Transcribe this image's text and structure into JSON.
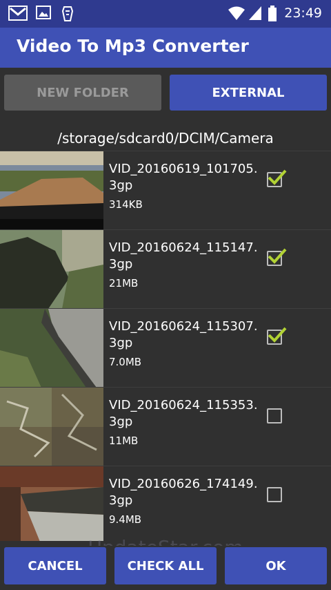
{
  "status_bar": {
    "time": "23:49",
    "icons": [
      "gmail-icon",
      "gallery-icon",
      "app-icon",
      "wifi-icon",
      "signal-icon",
      "battery-icon"
    ]
  },
  "app_bar": {
    "title": "Video To Mp3 Converter"
  },
  "top_buttons": {
    "new_folder": "NEW FOLDER",
    "external": "EXTERNAL"
  },
  "path": "/storage/sdcard0/DCIM/Camera",
  "files": [
    {
      "name": "VID_20160619_101705.3gp",
      "size": "314KB",
      "checked": true
    },
    {
      "name": "VID_20160624_115147.3gp",
      "size": "21MB",
      "checked": true
    },
    {
      "name": "VID_20160624_115307.3gp",
      "size": "7.0MB",
      "checked": true
    },
    {
      "name": "VID_20160624_115353.3gp",
      "size": "11MB",
      "checked": false
    },
    {
      "name": "VID_20160626_174149.3gp",
      "size": "9.4MB",
      "checked": false
    }
  ],
  "watermark": "UpdateStar.com",
  "bottom_buttons": {
    "cancel": "CANCEL",
    "check_all": "CHECK ALL",
    "ok": "OK"
  },
  "colors": {
    "primary": "#3f51b5",
    "status": "#2f3a8f",
    "check": "#b2d234",
    "background": "#303030"
  }
}
